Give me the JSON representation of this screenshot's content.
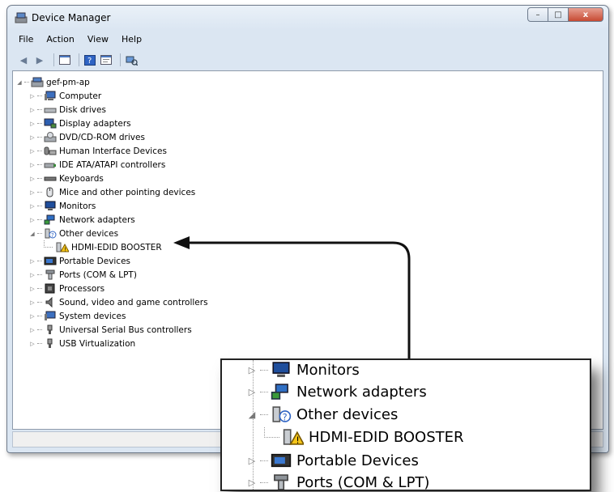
{
  "window": {
    "title": "Device Manager"
  },
  "caption_buttons": {
    "minimize": "–",
    "maximize": "□",
    "close": "x"
  },
  "menu": [
    "File",
    "Action",
    "View",
    "Help"
  ],
  "tree": {
    "root": "gef-pm-ap",
    "items": [
      "Computer",
      "Disk drives",
      "Display adapters",
      "DVD/CD-ROM drives",
      "Human Interface Devices",
      "IDE ATA/ATAPI controllers",
      "Keyboards",
      "Mice and other pointing devices",
      "Monitors",
      "Network adapters",
      "Other devices",
      "HDMI-EDID BOOSTER",
      "Portable Devices",
      "Ports (COM & LPT)",
      "Processors",
      "Sound, video and game controllers",
      "System devices",
      "Universal Serial Bus controllers",
      "USB Virtualization"
    ]
  },
  "zoom": {
    "items": [
      "Monitors",
      "Network adapters",
      "Other devices",
      "HDMI-EDID BOOSTER",
      "Portable Devices",
      "Ports (COM & LPT)"
    ]
  },
  "colors": {
    "accent": "#1f4e9c",
    "warning": "#f5c518"
  }
}
